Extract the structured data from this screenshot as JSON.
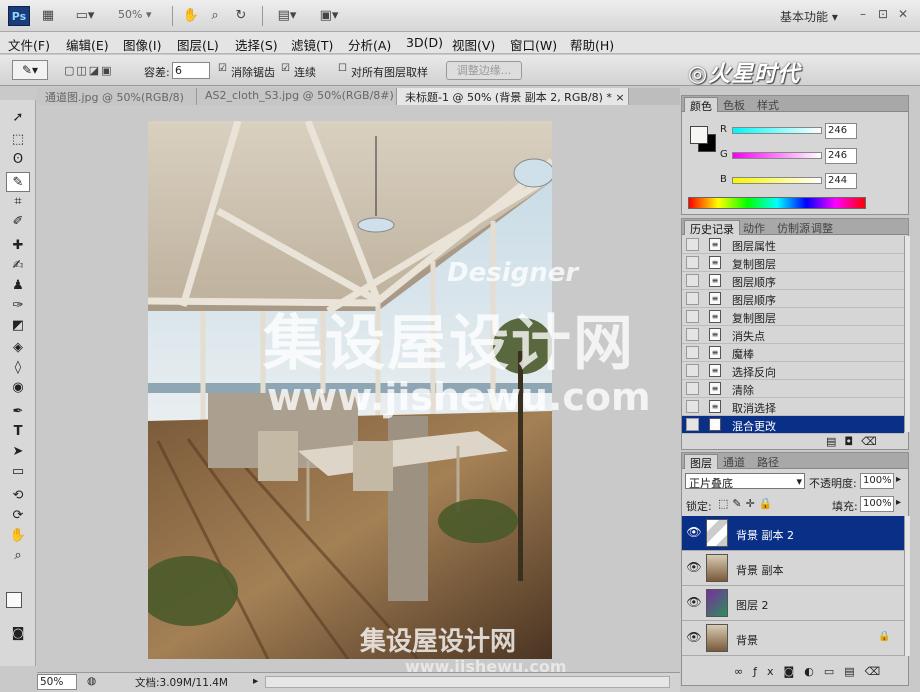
{
  "app": {
    "logo": "Ps",
    "zoom_select": "50% ▾",
    "workspace": "基本功能 ▾",
    "win_minimize": "–",
    "win_restore": "⊡",
    "win_close": "✕"
  },
  "menu": [
    "文件(F)",
    "编辑(E)",
    "图像(I)",
    "图层(L)",
    "选择(S)",
    "滤镜(T)",
    "分析(A)",
    "3D(D)",
    "视图(V)",
    "窗口(W)",
    "帮助(H)"
  ],
  "options": {
    "tolerance_label": "容差:",
    "tolerance_value": "6",
    "antialias_label": "消除锯齿",
    "contiguous_label": "连续",
    "sample_all_label": "对所有图层取样",
    "refine_edge_label": "调整边缘..."
  },
  "brand": "火星时代",
  "doc_tabs": [
    "通道图.jpg @ 50%(RGB/8)",
    "AS2_cloth_S3.jpg @ 50%(RGB/8#)",
    "未标题-1 @ 50% (背景 副本 2, RGB/8) *"
  ],
  "doc_tab_close": "×",
  "status": {
    "zoom": "50%",
    "doc_info": "文档:3.09M/11.4M"
  },
  "color_panel": {
    "tabs": [
      "颜色",
      "色板",
      "样式"
    ],
    "r_label": "R",
    "g_label": "G",
    "b_label": "B",
    "r": "246",
    "g": "246",
    "b": "244",
    "r_level": 0.965,
    "g_level": 0.965,
    "b_level": 0.957,
    "fg_color": "#f6f6f4",
    "bg_color": "#000000"
  },
  "history_panel": {
    "tabs": [
      "历史记录",
      "动作",
      "仿制源",
      "调整"
    ],
    "items": [
      "图层属性",
      "复制图层",
      "图层顺序",
      "图层顺序",
      "复制图层",
      "消失点",
      "魔棒",
      "选择反向",
      "清除",
      "取消选择",
      "混合更改"
    ],
    "selected_index": 10
  },
  "layers_panel": {
    "tabs": [
      "图层",
      "通道",
      "路径"
    ],
    "blend_mode": "正片叠底",
    "opacity_label": "不透明度:",
    "opacity": "100%",
    "lock_label": "锁定:",
    "fill_label": "填充:",
    "fill": "100%",
    "layers": [
      "背景 副本 2",
      "背景 副本",
      "图层 2",
      "背景"
    ],
    "selected_index": 0
  },
  "watermarks": {
    "designer": "Designer",
    "site_cn": "集设屋设计网",
    "site_url": "www.jishewu.com"
  },
  "colors": {
    "selection_blue": "#0a2f86",
    "accent": "#1a3d7a"
  }
}
